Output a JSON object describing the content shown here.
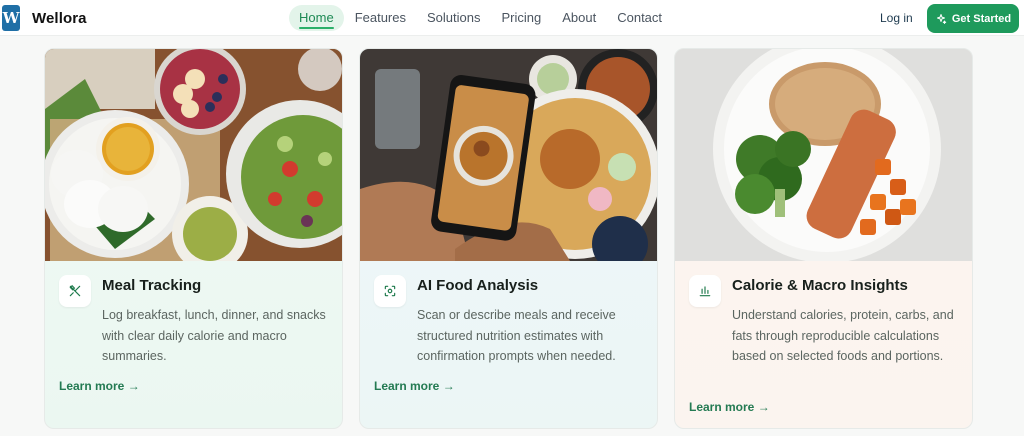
{
  "header": {
    "logo_letter": "W",
    "brand": "Wellora",
    "nav": [
      "Home",
      "Features",
      "Solutions",
      "Pricing",
      "About",
      "Contact"
    ],
    "active_nav": "Home",
    "login_label": "Log in",
    "cta_label": "Get Started"
  },
  "features": [
    {
      "title": "Meal Tracking",
      "description": "Log breakfast, lunch, dinner, and snacks with clear daily calorie and macro summaries.",
      "link": "Learn more →",
      "icon": "utensils-icon"
    },
    {
      "title": "AI Food Analysis",
      "description": "Scan or describe meals and receive structured nutrition estimates with confirmation prompts when needed.",
      "link": "Learn more →",
      "icon": "scan-icon"
    },
    {
      "title": "Calorie & Macro Insights",
      "description": "Understand calories, protein, carbs, and fats through reproducible calculations based on selected foods and portions.",
      "link": "Learn more →",
      "icon": "bar-chart-icon"
    }
  ],
  "colors": {
    "accent": "#1e9a5c",
    "link": "#237a52",
    "nav_active_bg": "#e3f4ea"
  }
}
